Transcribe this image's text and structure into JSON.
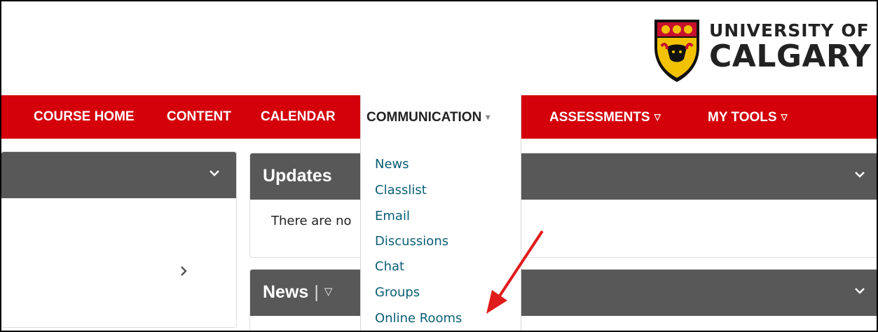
{
  "brand": {
    "line1": "UNIVERSITY OF",
    "line2": "CALGARY",
    "shield_colors": {
      "red": "#c8102e",
      "gold": "#f2c200",
      "black": "#111111"
    }
  },
  "navbar": {
    "background": "#d4000a",
    "items": [
      {
        "label": "COURSE HOME",
        "has_menu": false
      },
      {
        "label": "CONTENT",
        "has_menu": false
      },
      {
        "label": "CALENDAR",
        "has_menu": false
      },
      {
        "label": "COMMUNICATION",
        "has_menu": true,
        "active": true
      },
      {
        "label": "ASSESSMENTS",
        "has_menu": true
      },
      {
        "label": "MY TOOLS",
        "has_menu": true
      }
    ],
    "menu_arrow": "▽",
    "active_arrow": "▾"
  },
  "communication_menu": {
    "items": [
      "News",
      "Classlist",
      "Email",
      "Discussions",
      "Chat",
      "Groups",
      "Online Rooms"
    ],
    "link_color": "#0b5e75"
  },
  "widgets": {
    "left": {
      "title": ""
    },
    "updates": {
      "title": "Updates",
      "body": "There are no"
    },
    "news": {
      "title": "News",
      "separator": "|",
      "menu_arrow": "▽"
    }
  },
  "annotation": {
    "arrow_color": "#e01b1b",
    "points_to": "Online Rooms"
  }
}
